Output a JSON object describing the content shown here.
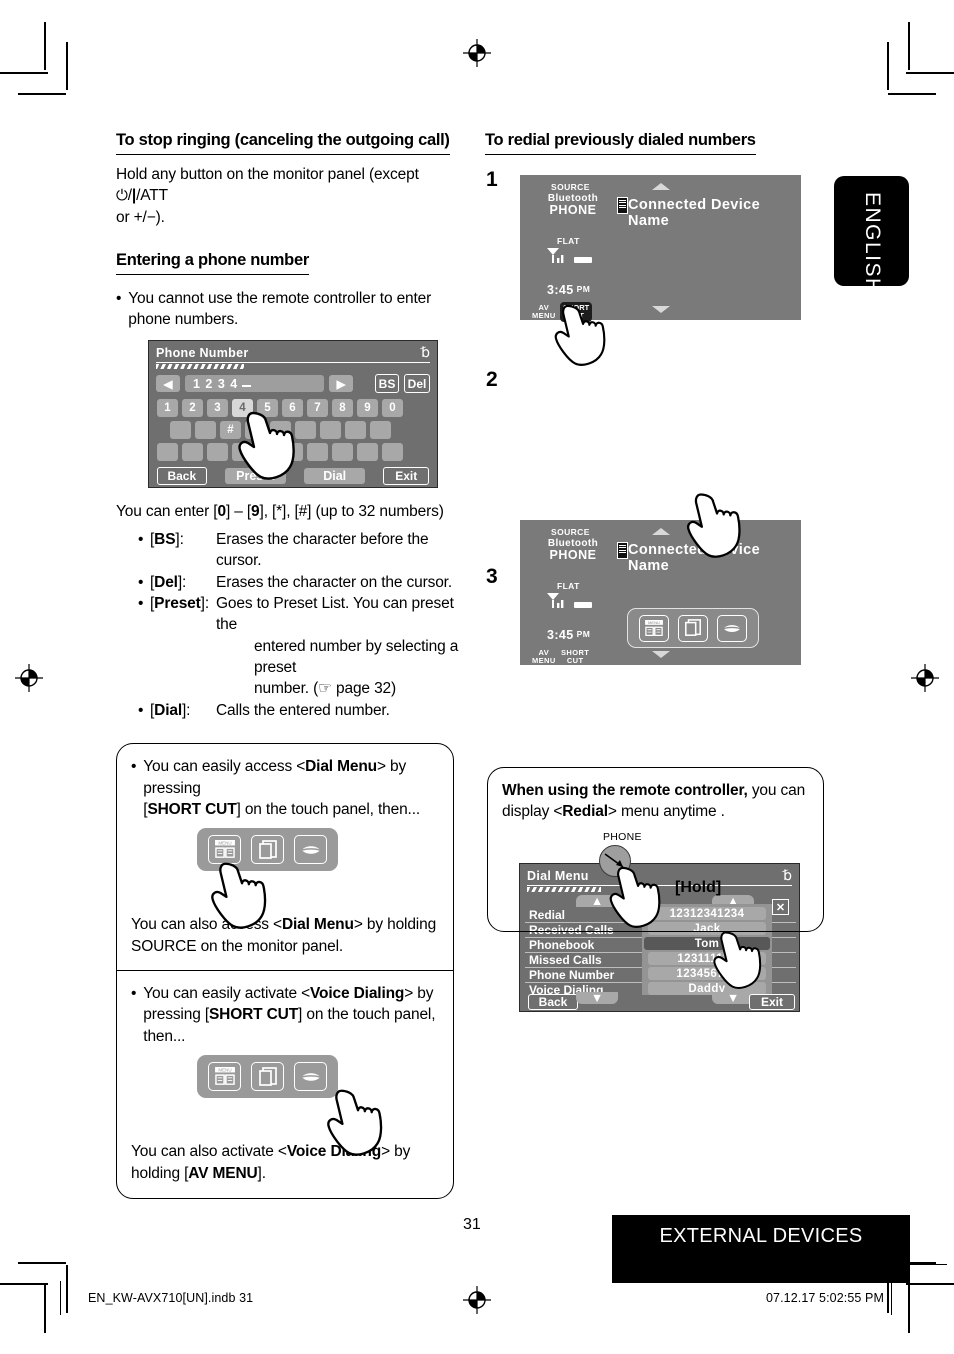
{
  "page": {
    "language_tab": "ENGLISH",
    "page_number": "31",
    "footer_band": "EXTERNAL DEVICES",
    "indb_file": "EN_KW-AVX710[UN].indb   31",
    "print_stamp": "07.12.17   5:02:55 PM"
  },
  "left": {
    "heading1": "To stop ringing (canceling the outgoing call)",
    "para1_a": "Hold any button on the monitor panel (except ",
    "para1_b": "/ATT",
    "para1_c": "or +/−).",
    "heading2": "Entering a phone number",
    "bullet1": "You cannot use the remote controller to enter phone numbers.",
    "enter_line": "You can enter [0] – [9], [*], [#] (up to 32 numbers)",
    "defs": [
      {
        "key": "[BS]:",
        "value": "Erases the character before the cursor."
      },
      {
        "key": "[Del]:",
        "value": "Erases the character on the cursor."
      },
      {
        "key": "[Preset]:",
        "value": "Goes to Preset List. You can preset the"
      },
      {
        "key": "",
        "value": "entered number by selecting a preset"
      },
      {
        "key": "",
        "value": "number. (☞ page 32)"
      },
      {
        "key": "[Dial]:",
        "value": "Calls the entered number."
      }
    ],
    "note": {
      "b1_line1_pre": "You can easily access <",
      "b1_line1_bold": "Dial Menu",
      "b1_line1_post": "> by pressing",
      "b1_line2_pre": "[",
      "b1_line2_bold": "SHORT CUT",
      "b1_line2_post": "] on the touch panel, then...",
      "b1_after_pre": "You can also access <",
      "b1_after_bold": "Dial Menu",
      "b1_after_post": "> by holding SOURCE on the monitor panel.",
      "b2_line1_pre": "You can easily activate <",
      "b2_line1_bold": "Voice Dialing",
      "b2_line1_post": "> by",
      "b2_line2_pre": "pressing [",
      "b2_line2_bold": "SHORT CUT",
      "b2_line2_post": "] on the touch panel, then...",
      "b2_after_pre": "You can also activate <",
      "b2_after_bold": "Voice Dialing",
      "b2_after_post": "> by holding [",
      "b2_after_bold2": "AV MENU",
      "b2_after_post2": "]."
    }
  },
  "phone_number_screen": {
    "title": "Phone Number",
    "bt_icon": "bluetooth-icon",
    "entered_number": "1 2 3 4",
    "bs_label": "BS",
    "del_label": "Del",
    "keys_row1": [
      "1",
      "2",
      "3",
      "4",
      "5",
      "6",
      "7",
      "8",
      "9",
      "0"
    ],
    "selected_key": "4",
    "keys_row2": [
      "",
      "",
      "#",
      "",
      "",
      "",
      "",
      "",
      ""
    ],
    "keys_row3": [
      "",
      "",
      "",
      "",
      "*",
      "",
      "",
      "",
      "",
      ""
    ],
    "back_label": "Back",
    "preset_label": "Preset",
    "dial_label": "Dial",
    "exit_label": "Exit"
  },
  "right": {
    "heading": "To redial previously dialed numbers",
    "steps": [
      "1",
      "2",
      "3"
    ],
    "device_screen": {
      "source_label": "SOURCE",
      "bluetooth_label": "Bluetooth",
      "phone_label": "PHONE",
      "flat_label": "FLAT",
      "time": "3:45",
      "ampm": "PM",
      "device_name": "Connected Device Name",
      "av_menu_line1": "AV",
      "av_menu_line2": "MENU",
      "shortcut_line1": "SHORT",
      "shortcut_line2": "CUT"
    },
    "shortcut_icons": [
      "menu-book-icon",
      "copy-pages-icon",
      "lips-voice-icon"
    ],
    "dial_menu_screen": {
      "title": "Dial Menu",
      "bt_icon": "bluetooth-icon",
      "items": [
        "Redial",
        "Received Calls",
        "Phonebook",
        "Missed Calls",
        "Phone Number",
        "Voice Dialing"
      ],
      "redial_entries": [
        "12312341234",
        "Jack",
        "Tom",
        "123111122",
        "123456789",
        "Daddy"
      ],
      "selected_entry": "Tom",
      "back_label": "Back",
      "exit_label": "Exit",
      "close_icon": "close-x-icon"
    },
    "remote_note": {
      "bold_lead": "When using the remote controller,",
      "rest1": " you can",
      "line2_pre": "display <",
      "line2_bold": "Redial",
      "line2_post": "> menu anytime .",
      "phone_label": "PHONE",
      "hold_label": "[Hold]"
    }
  }
}
